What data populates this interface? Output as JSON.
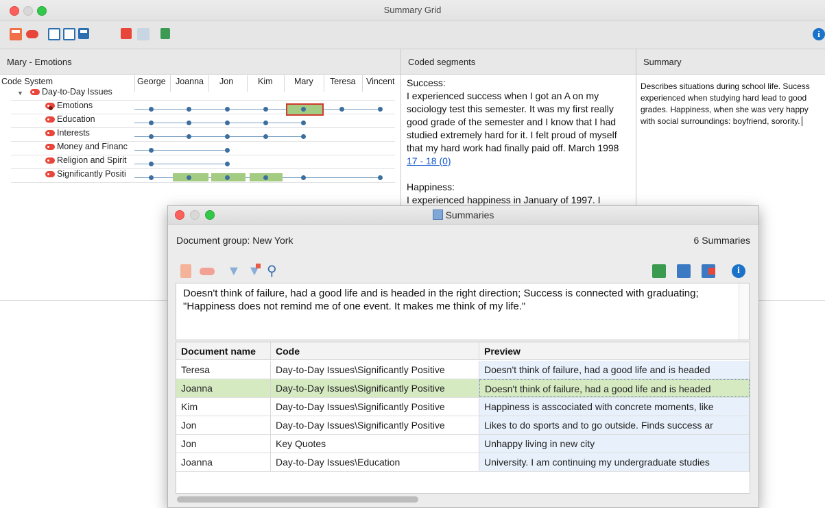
{
  "window": {
    "title": "Summary Grid"
  },
  "grid_pane": {
    "title": "Mary - Emotions",
    "code_system_header": "Code System",
    "columns": [
      "George",
      "Joanna",
      "Jon",
      "Kim",
      "Mary",
      "Teresa",
      "Vincent"
    ],
    "parent_code": "Day-to-Day Issues",
    "codes": [
      "Emotions",
      "Education",
      "Interests",
      "Money and Financ",
      "Religion and Spirit",
      "Significantly Positi"
    ]
  },
  "coded_pane": {
    "title": "Coded segments",
    "seg1_heading": "Success:",
    "seg1_text": "I experienced success when I got an A on my sociology test this semester. It was my first really good grade of the semester and I know that I had studied extremely hard for it. I felt proud of myself that my hard work had finally paid off. March 1998",
    "seg1_link": "17 - 18  (0)",
    "seg2_heading": "Happiness:",
    "seg2_text": "I experienced happiness in January of 1997. I"
  },
  "summary_pane": {
    "title": "Summary",
    "text": "Describes situations during school life. Sucess experienced when studying hard lead to good grades. Happiness, when she was very happy with social surroundings: boyfriend, sorority."
  },
  "dialog": {
    "title": "Summaries",
    "document_group": "Document group: New York",
    "count": "6 Summaries",
    "memo": "Doesn't think of failure, had a good life and is headed in the right direction; Success is connected with graduating; \"Happiness does not remind me of one event. It makes me think of my life.\"",
    "headers": {
      "doc": "Document name",
      "code": "Code",
      "preview": "Preview"
    },
    "rows": [
      {
        "doc": "Teresa",
        "code": "Day-to-Day Issues\\Significantly Positive",
        "preview": "Doesn't think of failure, had a good life and is headed"
      },
      {
        "doc": "Joanna",
        "code": "Day-to-Day Issues\\Significantly Positive",
        "preview": "Doesn't think of failure, had a good life and is headed"
      },
      {
        "doc": "Kim",
        "code": "Day-to-Day Issues\\Significantly Positive",
        "preview": "Happiness is asscociated with concrete moments, like"
      },
      {
        "doc": "Jon",
        "code": "Day-to-Day Issues\\Significantly Positive",
        "preview": "Likes to do sports and to go outside. Finds success ar"
      },
      {
        "doc": "Jon",
        "code": "Key Quotes",
        "preview": "Unhappy living in new city"
      },
      {
        "doc": "Joanna",
        "code": "Day-to-Day Issues\\Education",
        "preview": "University.  I am continuing my undergraduate studies"
      }
    ]
  },
  "colors": {
    "accent": "#1a73c8",
    "code_tag": "#e8463a",
    "highlight": "#a3cc82",
    "selected_row": "#d6eac2"
  },
  "icons": [
    "document-icon",
    "code-icon",
    "filter-icon",
    "clear-filter-icon",
    "search-icon",
    "excel-export-icon",
    "summary-table-icon",
    "export-icon",
    "info-icon"
  ]
}
